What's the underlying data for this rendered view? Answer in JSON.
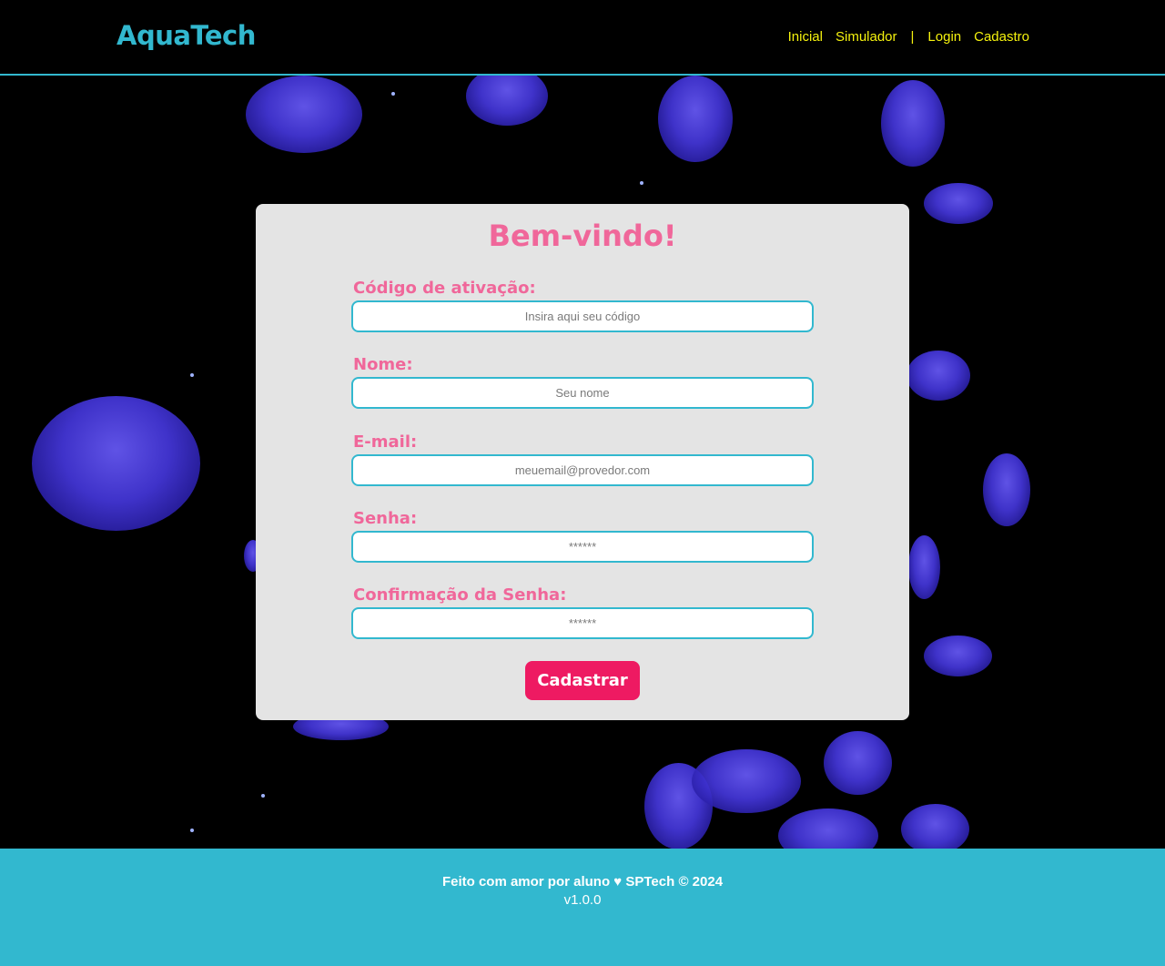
{
  "header": {
    "logo": "AquaTech",
    "nav": {
      "inicial": "Inicial",
      "simulador": "Simulador",
      "separator": "|",
      "login": "Login",
      "cadastro": "Cadastro"
    }
  },
  "form": {
    "title": "Bem-vindo!",
    "fields": [
      {
        "label": "Código de ativação:",
        "placeholder": "Insira aqui seu código"
      },
      {
        "label": "Nome:",
        "placeholder": "Seu nome"
      },
      {
        "label": "E-mail:",
        "placeholder": "meuemail@provedor.com"
      },
      {
        "label": "Senha:",
        "placeholder": "******"
      },
      {
        "label": "Confirmação da Senha:",
        "placeholder": "******"
      }
    ],
    "submit_label": "Cadastrar"
  },
  "footer": {
    "credit": "Feito com amor por aluno ♥ SPTech © 2024",
    "version": "v1.0.0"
  },
  "colors": {
    "accent": "#32b8cf",
    "nav_text": "#f5f20e",
    "title_pink": "#f0679a",
    "button": "#ee1a62",
    "card_bg": "#e4e4e4"
  }
}
